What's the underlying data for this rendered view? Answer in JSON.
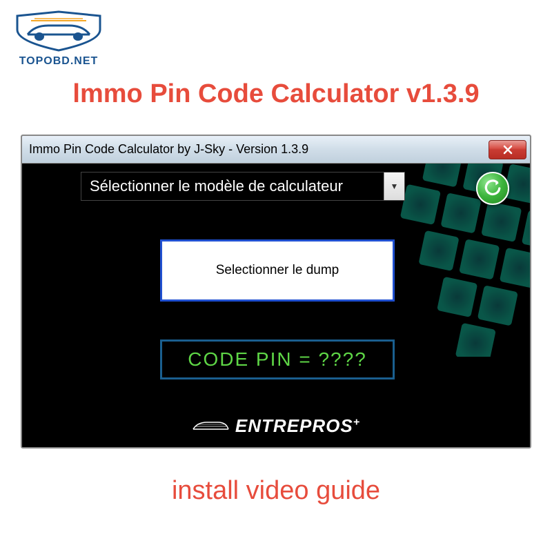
{
  "logo": {
    "text": "TOPOBD.NET"
  },
  "mainTitle": "lmmo Pin Code Calculator v1.3.9",
  "window": {
    "title": "Immo Pin Code Calculator by J-Sky  -  Version 1.3.9"
  },
  "dropdown": {
    "placeholder": "Sélectionner le modèle de calculateur"
  },
  "dumpButton": {
    "label": "Selectionner le dump"
  },
  "codeDisplay": {
    "text": "CODE PIN =  ????"
  },
  "brandName": "ENTREPROS",
  "brandSuffix": "+",
  "bottomText": "install video guide"
}
